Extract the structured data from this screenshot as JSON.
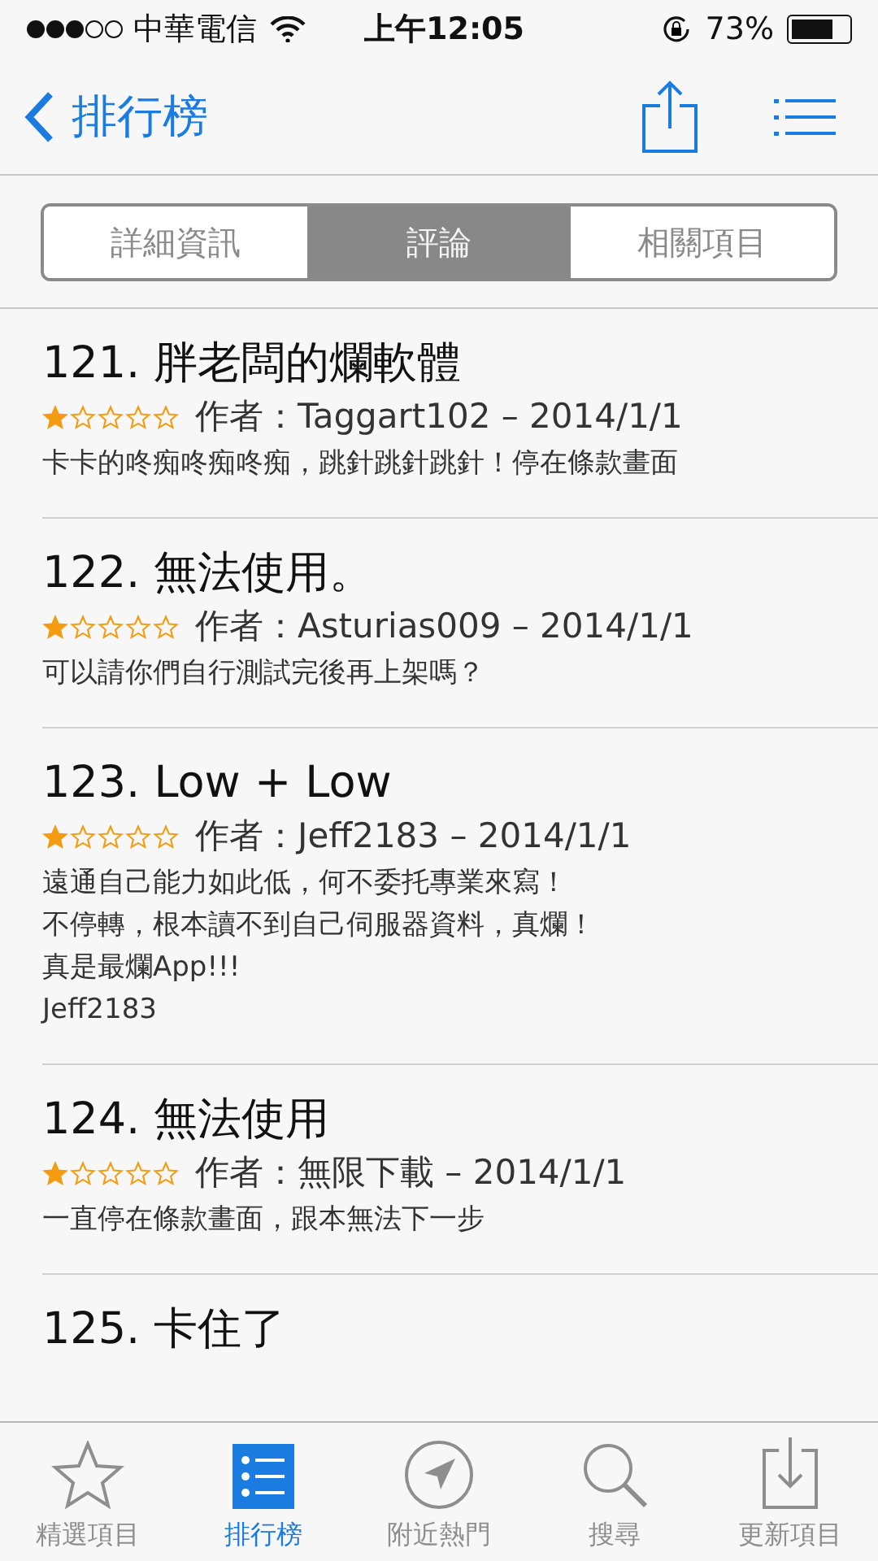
{
  "status_bar": {
    "carrier": "中華電信",
    "time": "上午12:05",
    "battery": "73%"
  },
  "nav": {
    "back": "排行榜"
  },
  "segments": [
    {
      "label": "詳細資訊",
      "selected": false
    },
    {
      "label": "評論",
      "selected": true
    },
    {
      "label": "相關項目",
      "selected": false
    }
  ],
  "reviews": [
    {
      "title": "121. 胖老闆的爛軟體",
      "stars": 1,
      "meta": "作者：Taggart102 – 2014/1/1",
      "body": [
        "卡卡的咚痴咚痴咚痴，跳針跳針跳針！停在條款畫面"
      ]
    },
    {
      "title": "122. 無法使用。",
      "stars": 1,
      "meta": "作者：Asturias009 – 2014/1/1",
      "body": [
        "可以請你們自行測試完後再上架嗎？"
      ]
    },
    {
      "title": "123. Low + Low",
      "stars": 1,
      "meta": "作者：Jeff2183 – 2014/1/1",
      "body": [
        "遠通自己能力如此低，何不委托專業來寫！",
        "不停轉，根本讀不到自己伺服器資料，真爛！",
        "真是最爛App!!!",
        "Jeff2183"
      ]
    },
    {
      "title": "124. 無法使用",
      "stars": 1,
      "meta": "作者：無限下載 – 2014/1/1",
      "body": [
        "一直停在條款畫面，跟本無法下一步"
      ]
    },
    {
      "title": "125. 卡住了"
    }
  ],
  "tab_bar": [
    {
      "label": "精選項目",
      "kind": "star",
      "selected": false
    },
    {
      "label": "排行榜",
      "kind": "list",
      "selected": true
    },
    {
      "label": "附近熱門",
      "kind": "nearby",
      "selected": false
    },
    {
      "label": "搜尋",
      "kind": "search",
      "selected": false
    },
    {
      "label": "更新項目",
      "kind": "updates",
      "selected": false
    }
  ]
}
